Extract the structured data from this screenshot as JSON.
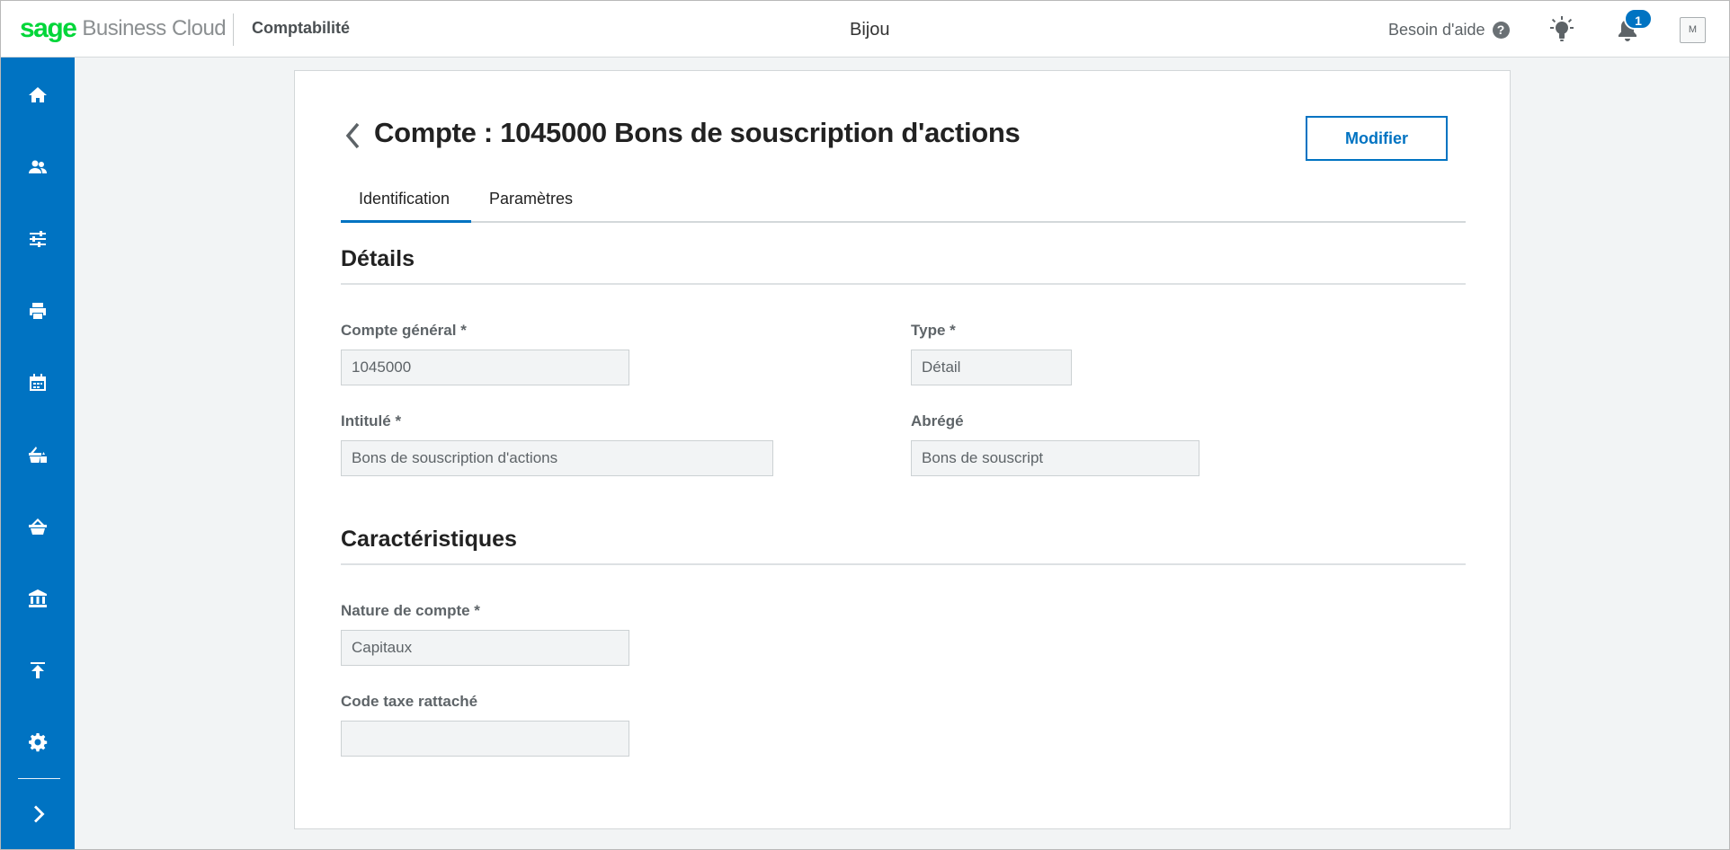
{
  "topbar": {
    "brand_sage": "sage",
    "brand_cloud": "Business Cloud",
    "app_name": "Comptabilité",
    "company": "Bijou",
    "help_label": "Besoin d'aide",
    "help_icon": "?",
    "notification_count": "1",
    "avatar_initial": "M"
  },
  "sidebar": {
    "items": [
      {
        "icon": "home-icon"
      },
      {
        "icon": "contacts-icon"
      },
      {
        "icon": "sliders-icon"
      },
      {
        "icon": "printer-icon"
      },
      {
        "icon": "calendar-icon"
      },
      {
        "icon": "sales-basket-icon"
      },
      {
        "icon": "purchases-basket-icon"
      },
      {
        "icon": "bank-icon"
      },
      {
        "icon": "upload-icon"
      },
      {
        "icon": "settings-icon"
      },
      {
        "icon": "expand-chevron-icon"
      }
    ]
  },
  "page": {
    "title": "Compte : 1045000 Bons de souscription d'actions",
    "edit_button": "Modifier",
    "tabs": [
      {
        "label": "Identification",
        "active": true
      },
      {
        "label": "Paramètres",
        "active": false
      }
    ]
  },
  "details": {
    "title": "Détails",
    "compte_general": {
      "label": "Compte général *",
      "value": "1045000"
    },
    "type": {
      "label": "Type *",
      "value": "Détail"
    },
    "intitule": {
      "label": "Intitulé *",
      "value": "Bons de souscription d'actions"
    },
    "abrege": {
      "label": "Abrégé",
      "value": "Bons de souscript"
    }
  },
  "caracteristiques": {
    "title": "Caractéristiques",
    "nature_compte": {
      "label": "Nature de compte *",
      "value": "Capitaux"
    },
    "code_taxe": {
      "label": "Code taxe rattaché",
      "value": ""
    }
  },
  "colors": {
    "brand_green": "#00d639",
    "primary_blue": "#0073c2",
    "input_bg": "#f2f4f5"
  }
}
